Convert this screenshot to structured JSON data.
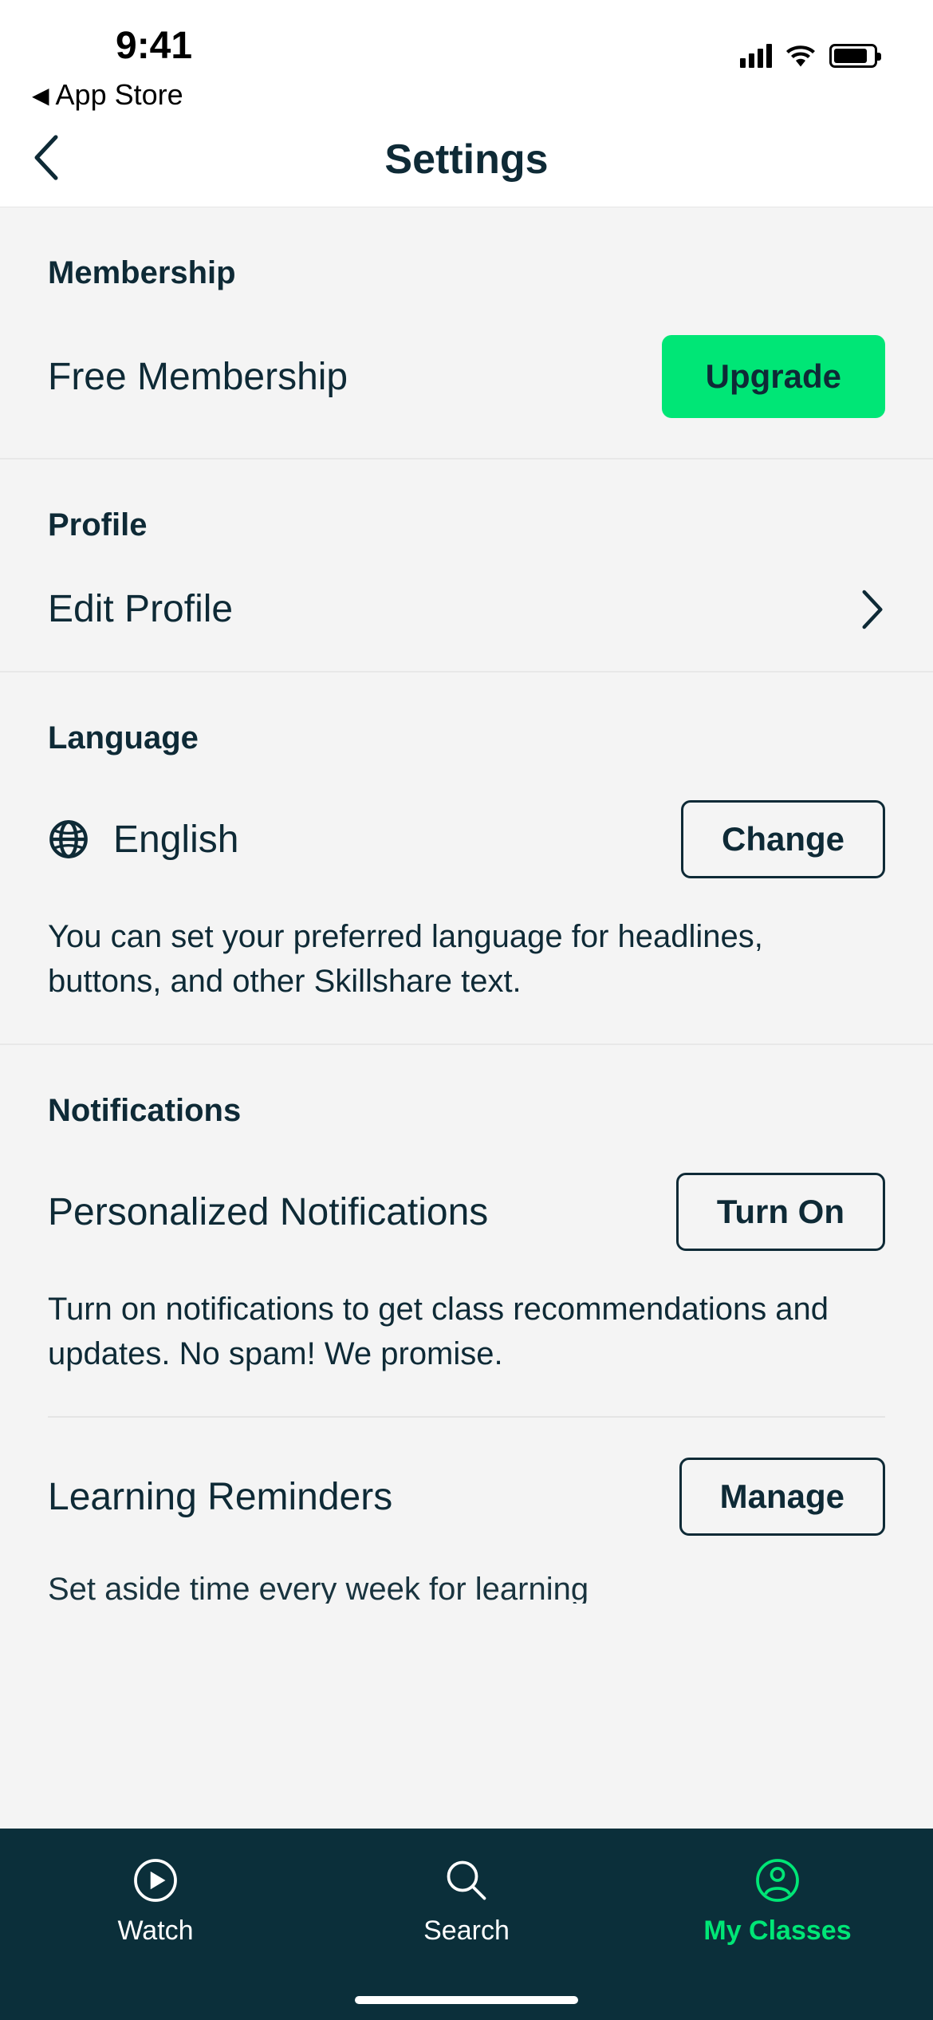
{
  "status_bar": {
    "time": "9:41",
    "back_to_app": "App Store"
  },
  "header": {
    "title": "Settings"
  },
  "sections": {
    "membership": {
      "header": "Membership",
      "status": "Free Membership",
      "button": "Upgrade"
    },
    "profile": {
      "header": "Profile",
      "edit_label": "Edit Profile"
    },
    "language": {
      "header": "Language",
      "current": "English",
      "button": "Change",
      "description": "You can set your preferred language for headlines, buttons, and other Skillshare text."
    },
    "notifications": {
      "header": "Notifications",
      "personalized_label": "Personalized Notifications",
      "personalized_button": "Turn On",
      "personalized_desc": "Turn on notifications to get class recommendations and updates. No spam! We promise.",
      "reminders_label": "Learning Reminders",
      "reminders_button": "Manage",
      "reminders_desc": "Set aside time every week for learning"
    }
  },
  "tabs": {
    "watch": "Watch",
    "search": "Search",
    "my_classes": "My Classes"
  }
}
